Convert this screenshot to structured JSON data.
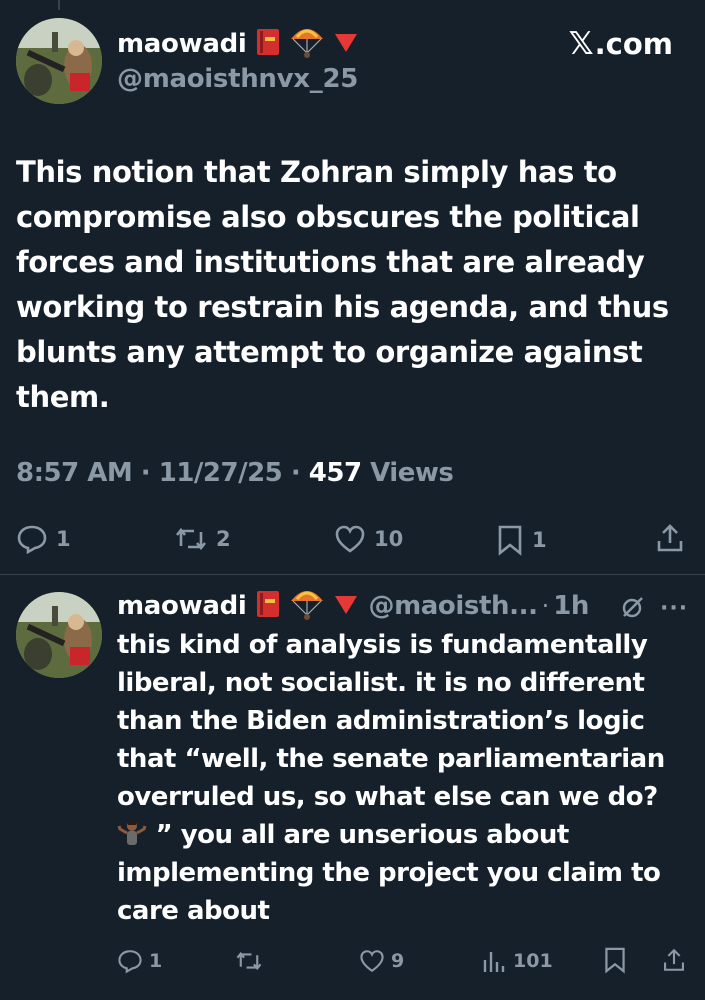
{
  "post": {
    "display_name": "maowadi",
    "handle": "@maoisthnvx_25",
    "emojis": [
      "red-book-emoji",
      "parachute-emoji",
      "red-down-triangle-emoji"
    ],
    "body": "This notion that Zohran simply has to compromise also obscures the political forces and institutions that are already working to restrain his agenda, and thus blunts any attempt to organize against them.",
    "time": "8:57 AM",
    "sep1": "·",
    "date": "11/27/25",
    "sep2": "·",
    "views": "457",
    "views_label": "Views",
    "actions": {
      "replies": "1",
      "reposts": "2",
      "likes": "10",
      "bookmarks": "1"
    }
  },
  "watermark": {
    "x_glyph": "𝕏",
    "text": ".com"
  },
  "reply": {
    "display_name": "maowadi",
    "handle": "@maoisth...",
    "dot": "·",
    "time": "1h",
    "more": "···",
    "body_part1": "this kind of analysis is fundamentally liberal, not socialist. it is no different than the Biden administration’s logic that “well, the senate parliamentarian overruled us, so what else can we do?",
    "body_part2": "” you all are unserious about implementing the project you claim to care about",
    "actions": {
      "replies": "1",
      "reposts": "",
      "likes": "9",
      "views": "101"
    }
  },
  "colors": {
    "background": "#15202b",
    "text": "#ffffff",
    "muted": "#8b98a5",
    "divider": "#38444d"
  }
}
